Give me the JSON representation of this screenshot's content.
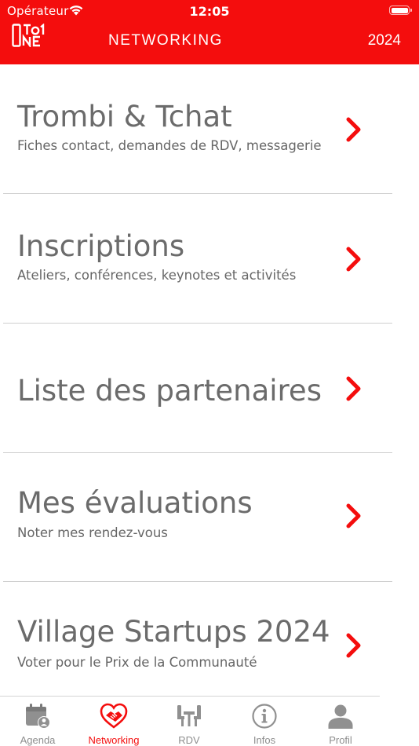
{
  "status_bar": {
    "carrier": "Opérateur",
    "time": "12:05"
  },
  "header": {
    "title": "NETWORKING",
    "year": "2024",
    "background": "#f40d0d"
  },
  "menu": {
    "items": [
      {
        "title": "Trombi & Tchat",
        "subtitle": "Fiches contact, demandes de RDV, messagerie"
      },
      {
        "title": "Inscriptions",
        "subtitle": "Ateliers, conférences, keynotes et activités"
      },
      {
        "title": "Liste des partenaires",
        "subtitle": ""
      },
      {
        "title": "Mes évaluations",
        "subtitle": "Noter mes rendez-vous"
      },
      {
        "title": "Village Startups 2024",
        "subtitle": "Voter pour le Prix de la Communauté"
      }
    ],
    "chevron_icon": "chevron-right-icon",
    "chevron_color": "#f40d0d"
  },
  "tabbar": {
    "tabs": [
      {
        "label": "Agenda",
        "icon": "calendar-user-icon"
      },
      {
        "label": "Networking",
        "icon": "handshake-heart-icon",
        "active": true
      },
      {
        "label": "RDV",
        "icon": "meeting-table-icon"
      },
      {
        "label": "Infos",
        "icon": "info-circle-icon"
      },
      {
        "label": "Profil",
        "icon": "person-icon"
      }
    ],
    "active_color": "#f40d0d",
    "inactive_color": "#8e8e8e"
  }
}
